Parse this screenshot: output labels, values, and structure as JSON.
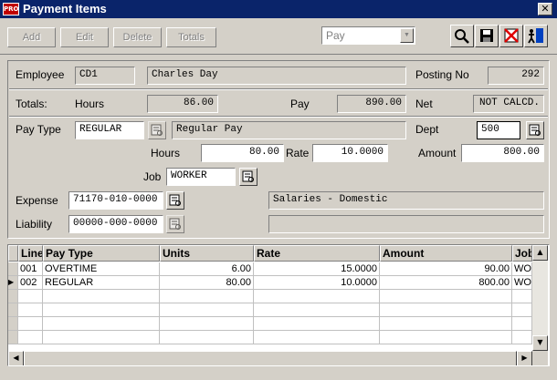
{
  "window": {
    "title": "Payment Items",
    "app_icon_text": "PRO",
    "close_glyph": "✕"
  },
  "toolbar": {
    "add_label": "Add",
    "edit_label": "Edit",
    "delete_label": "Delete",
    "totals_label": "Totals",
    "type_select": "Pay",
    "icons": [
      "search-icon",
      "save-icon",
      "cancel-icon",
      "exit-icon"
    ]
  },
  "header": {
    "employee_label": "Employee",
    "employee_code": "CD1",
    "employee_name": "Charles Day",
    "posting_label": "Posting No",
    "posting_no": "292"
  },
  "totals": {
    "label": "Totals:",
    "hours_label": "Hours",
    "hours": "86.00",
    "pay_label": "Pay",
    "pay": "890.00",
    "net_label": "Net",
    "net": "NOT CALCD."
  },
  "detail": {
    "pay_type_label": "Pay Type",
    "pay_type_code": "REGULAR",
    "pay_type_desc": "Regular Pay",
    "dept_label": "Dept",
    "dept": "500",
    "hours_label": "Hours",
    "hours": "80.00",
    "rate_label": "Rate",
    "rate": "10.0000",
    "amount_label": "Amount",
    "amount": "800.00",
    "job_label": "Job",
    "job": "WORKER",
    "expense_label": "Expense",
    "expense_account": "71170-010-0000",
    "expense_desc": "Salaries - Domestic",
    "liability_label": "Liability",
    "liability_account": "00000-000-0000",
    "liability_desc": ""
  },
  "grid": {
    "columns": [
      "Line",
      "Pay Type",
      "Units",
      "Rate",
      "Amount",
      "Job"
    ],
    "rows": [
      {
        "line": "001",
        "pay_type": "OVERTIME",
        "units": "6.00",
        "rate": "15.0000",
        "amount": "90.00",
        "job": "WOR",
        "current": false
      },
      {
        "line": "002",
        "pay_type": "REGULAR",
        "units": "80.00",
        "rate": "10.0000",
        "amount": "800.00",
        "job": "WOR",
        "current": true
      }
    ],
    "scroll_up": "▲",
    "scroll_down": "▼",
    "scroll_left": "◀",
    "scroll_right": "▶",
    "row_indicator": "▶"
  }
}
